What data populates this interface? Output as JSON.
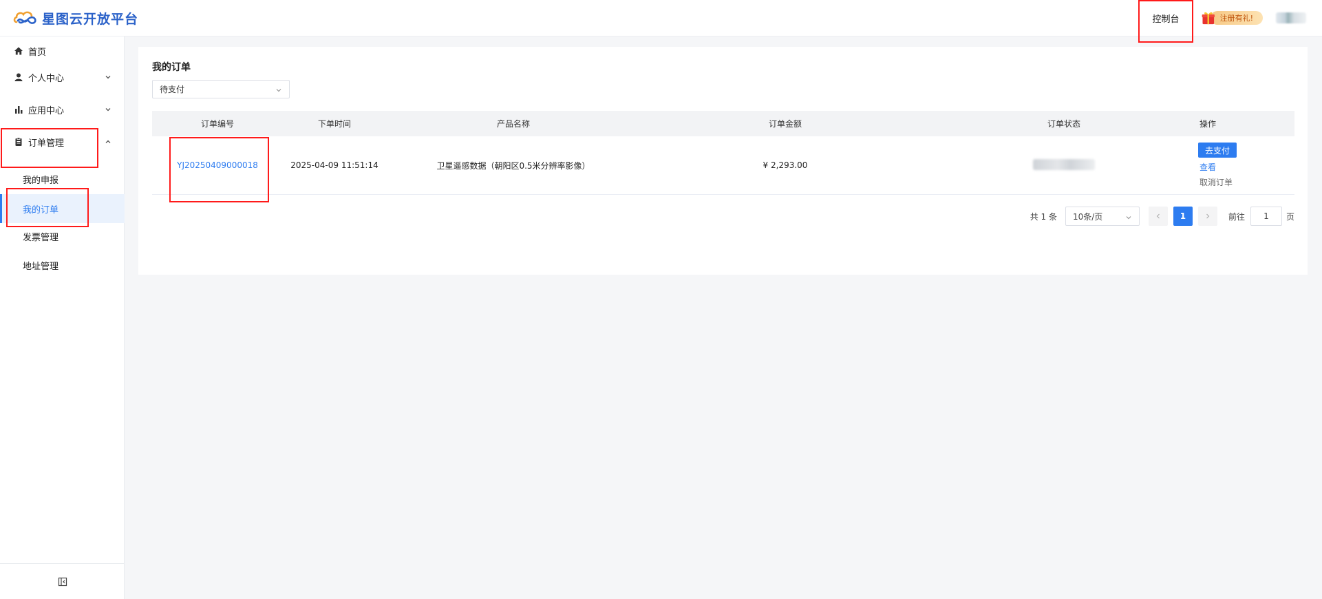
{
  "header": {
    "logo_text": "星图云开放平台",
    "console_label": "控制台",
    "gift_label": "注册有礼!"
  },
  "sidebar": {
    "items": [
      {
        "label": "首页",
        "icon": "home-icon"
      },
      {
        "label": "个人中心",
        "icon": "user-icon"
      },
      {
        "label": "应用中心",
        "icon": "bar-chart-icon"
      },
      {
        "label": "订单管理",
        "icon": "clipboard-icon"
      }
    ],
    "sub_items": [
      {
        "label": "我的申报"
      },
      {
        "label": "我的订单",
        "active": true
      },
      {
        "label": "发票管理"
      },
      {
        "label": "地址管理"
      }
    ]
  },
  "main": {
    "title": "我的订单",
    "status_filter": "待支付",
    "table": {
      "columns": [
        "订单编号",
        "下单时间",
        "产品名称",
        "订单金额",
        "订单状态",
        "操作"
      ],
      "rows": [
        {
          "order_no": "YJ20250409000018",
          "time": "2025-04-09 11:51:14",
          "product": "卫星遥感数据（朝阳区0.5米分辨率影像）",
          "amount": "¥ 2,293.00",
          "pay_label": "去支付",
          "view_label": "查看",
          "cancel_label": "取消订单"
        }
      ]
    },
    "pagination": {
      "total_text": "共 1 条",
      "page_size": "10条/页",
      "current_page": "1",
      "goto_label": "前往",
      "goto_value": "1",
      "page_suffix": "页"
    }
  },
  "colors": {
    "accent": "#2d7cf0",
    "highlight_border": "#ff1a1a"
  }
}
